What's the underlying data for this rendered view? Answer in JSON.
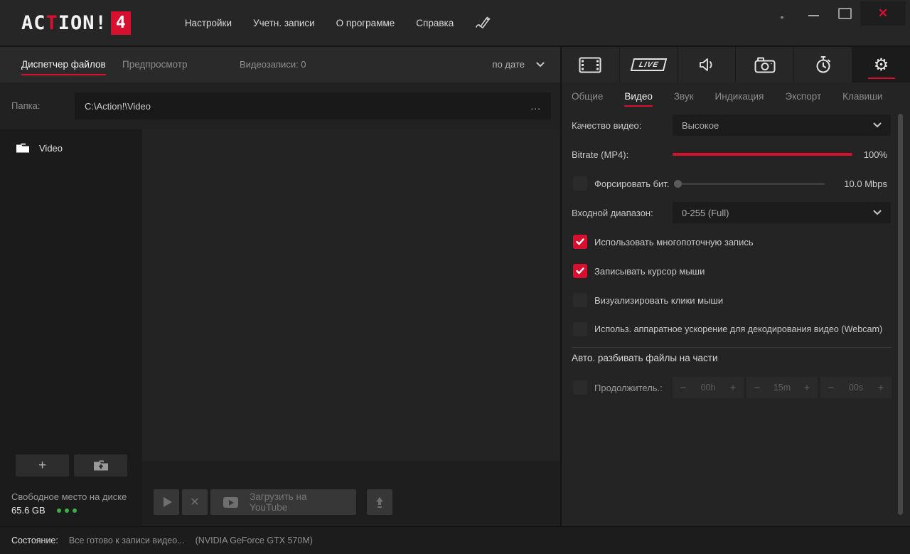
{
  "colors": {
    "accent": "#d8102f",
    "panel_bg": "#242424",
    "green_dot": "#3cb043"
  },
  "titlebar": {
    "logo_prefix": "AC",
    "logo_t": "T",
    "logo_suffix": "ION!",
    "logo_badge": "4",
    "menu": [
      {
        "label": "Настройки"
      },
      {
        "label": "Учетн. записи"
      },
      {
        "label": "О программе"
      },
      {
        "label": "Справка"
      }
    ],
    "close_glyph": "✕"
  },
  "files": {
    "tab_manager": "Диспетчер файлов",
    "tab_preview": "Предпросмотр",
    "recordings_count": "Видеозаписи: 0",
    "sort_by": "по дате",
    "folder_label": "Папка:",
    "folder_path": "C:\\Action!\\Video",
    "browse": "...",
    "tree_item": "Video",
    "add_button": "+",
    "free_space_label": "Свободное место на диске",
    "free_space_value": "65.6 GB",
    "delete_glyph": "✕",
    "youtube_button": "Загрузить на YouTube"
  },
  "settings": {
    "icons": {
      "gear": "⚙",
      "live_badge": "LIVE"
    },
    "tabs": [
      {
        "label": "Общие"
      },
      {
        "label": "Видео"
      },
      {
        "label": "Звук"
      },
      {
        "label": "Индикация"
      },
      {
        "label": "Экспорт"
      },
      {
        "label": "Клавиши"
      }
    ],
    "quality_label": "Качество видео:",
    "quality_value": "Высокое",
    "bitrate_label": "Bitrate (MP4):",
    "bitrate_value": "100%",
    "force_bitrate_label": "Форсировать бит.",
    "force_bitrate_value": "10.0 Mbps",
    "input_range_label": "Входной диапазон:",
    "input_range_value": "0-255 (Full)",
    "checkboxes": [
      {
        "label": "Использовать многопоточную запись",
        "checked": true
      },
      {
        "label": "Записывать курсор мыши",
        "checked": true
      },
      {
        "label": "Визуализировать клики мыши",
        "checked": false
      },
      {
        "label": "Использ. аппаратное ускорение для декодирования видео (Webcam)",
        "checked": false
      }
    ],
    "split_section_title": "Авто. разбивать файлы на части",
    "duration_label": "Продолжитель.:",
    "minus": "−",
    "plus": "+",
    "steppers": [
      {
        "value": "00h"
      },
      {
        "value": "15m"
      },
      {
        "value": "00s"
      }
    ]
  },
  "statusbar": {
    "label": "Состояние:",
    "message": "Все готово к записи видео...",
    "gpu": "(NVIDIA GeForce GTX 570M)"
  }
}
